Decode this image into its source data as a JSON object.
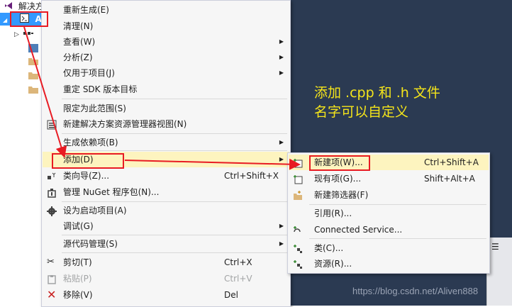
{
  "solution_explorer": {
    "title": "解决方",
    "project": "Al"
  },
  "annotation": {
    "line1": "添加 .cpp 和 .h 文件",
    "line2": "名字可以自定义"
  },
  "watermark": "https://blog.csdn.net/Aliven888",
  "context_menu": {
    "items": [
      {
        "label": "重新生成(E)"
      },
      {
        "label": "清理(N)"
      },
      {
        "label": "查看(W)"
      },
      {
        "label": "分析(Z)"
      },
      {
        "label": "仅用于项目(J)"
      },
      {
        "label": "重定 SDK 版本目标"
      },
      {
        "label": "限定为此范围(S)"
      },
      {
        "label": "新建解决方案资源管理器视图(N)"
      },
      {
        "label": "生成依赖项(B)"
      },
      {
        "label": "添加(D)"
      },
      {
        "label": "类向导(Z)...",
        "shortcut": "Ctrl+Shift+X"
      },
      {
        "label": "管理 NuGet 程序包(N)..."
      },
      {
        "label": "设为启动项目(A)"
      },
      {
        "label": "调试(G)"
      },
      {
        "label": "源代码管理(S)"
      },
      {
        "label": "剪切(T)",
        "shortcut": "Ctrl+X"
      },
      {
        "label": "粘贴(P)",
        "shortcut": "Ctrl+V"
      },
      {
        "label": "移除(V)",
        "shortcut": "Del"
      }
    ]
  },
  "add_submenu": {
    "items": [
      {
        "label": "新建项(W)...",
        "shortcut": "Ctrl+Shift+A"
      },
      {
        "label": "现有项(G)...",
        "shortcut": "Shift+Alt+A"
      },
      {
        "label": "新建筛选器(F)"
      },
      {
        "label": "引用(R)..."
      },
      {
        "label": "Connected Service..."
      },
      {
        "label": "类(C)..."
      },
      {
        "label": "资源(R)..."
      }
    ]
  },
  "colors": {
    "highlight": "#fdf4bf",
    "annotation_text": "#f5e51a",
    "red_marker": "#e81b23",
    "editor_background": "#2b3a52"
  }
}
